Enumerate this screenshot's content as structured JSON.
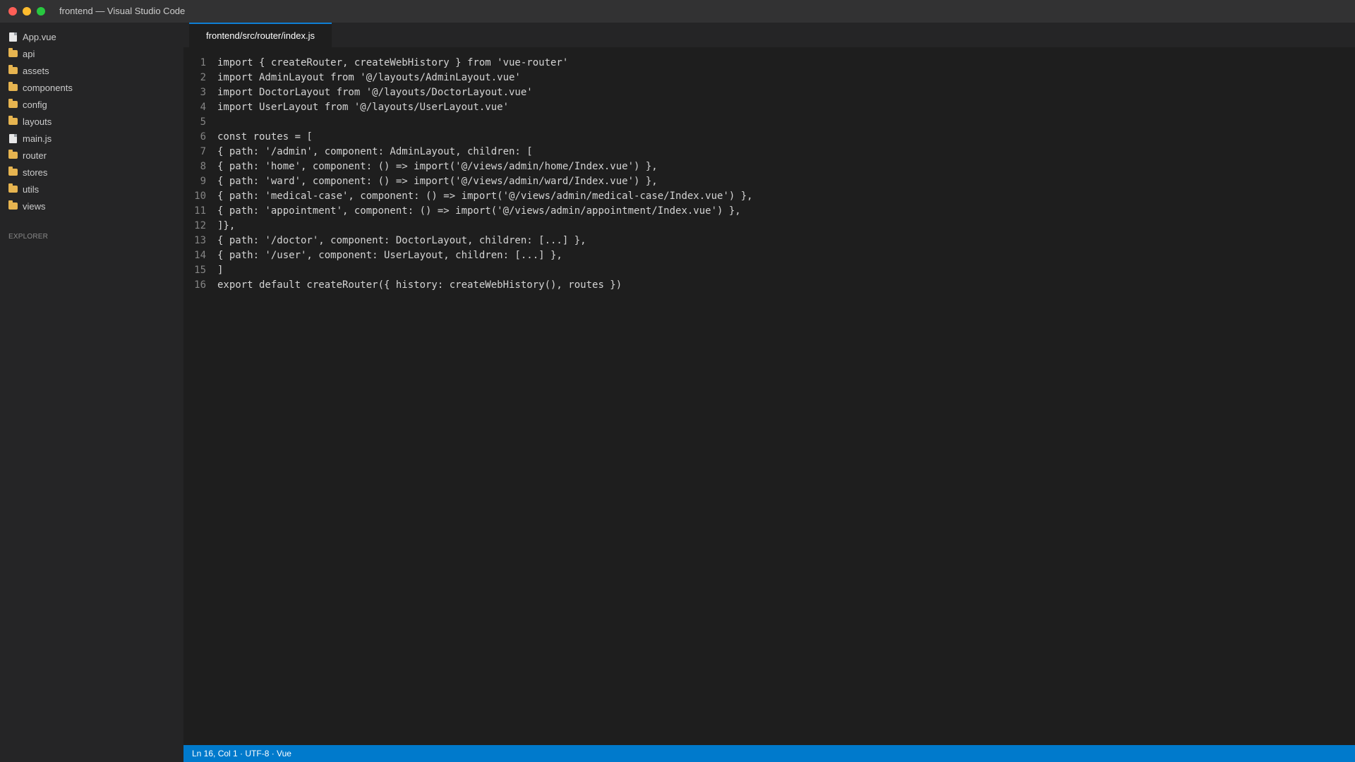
{
  "window": {
    "title": "frontend — Visual Studio Code"
  },
  "sidebar": {
    "items": [
      {
        "label": "App.vue",
        "type": "file",
        "icon": "file-icon"
      },
      {
        "label": "api",
        "type": "folder",
        "icon": "folder-icon"
      },
      {
        "label": "assets",
        "type": "folder",
        "icon": "folder-icon"
      },
      {
        "label": "components",
        "type": "folder",
        "icon": "folder-icon"
      },
      {
        "label": "config",
        "type": "folder",
        "icon": "folder-icon"
      },
      {
        "label": "layouts",
        "type": "folder",
        "icon": "folder-icon"
      },
      {
        "label": "main.js",
        "type": "file",
        "icon": "file-icon"
      },
      {
        "label": "router",
        "type": "folder",
        "icon": "folder-icon"
      },
      {
        "label": "stores",
        "type": "folder",
        "icon": "folder-icon"
      },
      {
        "label": "utils",
        "type": "folder",
        "icon": "folder-icon"
      },
      {
        "label": "views",
        "type": "folder",
        "icon": "folder-icon"
      }
    ],
    "section_label": "EXPLORER"
  },
  "tabs": [
    {
      "label": "frontend/src/router/index.js",
      "active": true
    }
  ],
  "editor": {
    "lines": [
      {
        "num": "1",
        "text": "import { createRouter, createWebHistory } from 'vue-router'"
      },
      {
        "num": "2",
        "text": "import AdminLayout from '@/layouts/AdminLayout.vue'"
      },
      {
        "num": "3",
        "text": "import DoctorLayout from '@/layouts/DoctorLayout.vue'"
      },
      {
        "num": "4",
        "text": "import UserLayout from '@/layouts/UserLayout.vue'"
      },
      {
        "num": "5",
        "text": ""
      },
      {
        "num": "6",
        "text": "const routes = ["
      },
      {
        "num": "7",
        "text": "{ path: '/admin', component: AdminLayout, children: ["
      },
      {
        "num": "8",
        "text": "{ path: 'home', component: () => import('@/views/admin/home/Index.vue') },"
      },
      {
        "num": "9",
        "text": "{ path: 'ward', component: () => import('@/views/admin/ward/Index.vue') },"
      },
      {
        "num": "10",
        "text": "{ path: 'medical-case', component: () => import('@/views/admin/medical-case/Index.vue') },"
      },
      {
        "num": "11",
        "text": "{ path: 'appointment', component: () => import('@/views/admin/appointment/Index.vue') },"
      },
      {
        "num": "12",
        "text": "]},"
      },
      {
        "num": "13",
        "text": "{ path: '/doctor', component: DoctorLayout, children: [...] },"
      },
      {
        "num": "14",
        "text": "{ path: '/user', component: UserLayout, children: [...] },"
      },
      {
        "num": "15",
        "text": "]"
      },
      {
        "num": "16",
        "text": "export default createRouter({ history: createWebHistory(), routes })"
      }
    ]
  },
  "status": {
    "text": "Ln 16, Col 1 · UTF-8 · Vue"
  },
  "colors": {
    "status_bar": "#007acc",
    "tab_accent": "#0e7fd4",
    "folder": "#e6b450",
    "close": "#ff5f57",
    "minimize": "#febc2e",
    "maximize": "#28c840"
  }
}
